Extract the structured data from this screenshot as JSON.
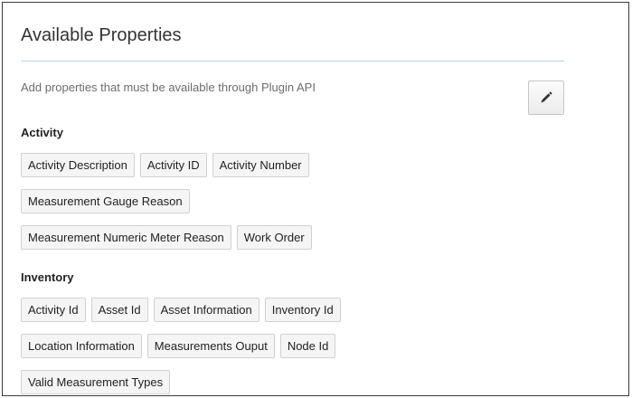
{
  "panel": {
    "title": "Available Properties",
    "description": "Add properties that must be available through Plugin API",
    "edit_icon": "pencil-icon"
  },
  "sections": [
    {
      "name": "Activity",
      "rows": [
        [
          "Activity Description",
          "Activity ID",
          "Activity Number"
        ],
        [
          "Measurement Gauge Reason"
        ],
        [
          "Measurement Numeric Meter Reason",
          "Work Order"
        ]
      ]
    },
    {
      "name": "Inventory",
      "rows": [
        [
          "Activity Id",
          "Asset Id",
          "Asset Information",
          "Inventory Id"
        ],
        [
          "Location Information",
          "Measurements Ouput",
          "Node Id"
        ],
        [
          "Valid Measurement Types"
        ]
      ]
    }
  ],
  "colors": {
    "divider": "#b9d3ea",
    "chip_background": "#f5f5f5",
    "chip_border": "#d1d1d1"
  }
}
